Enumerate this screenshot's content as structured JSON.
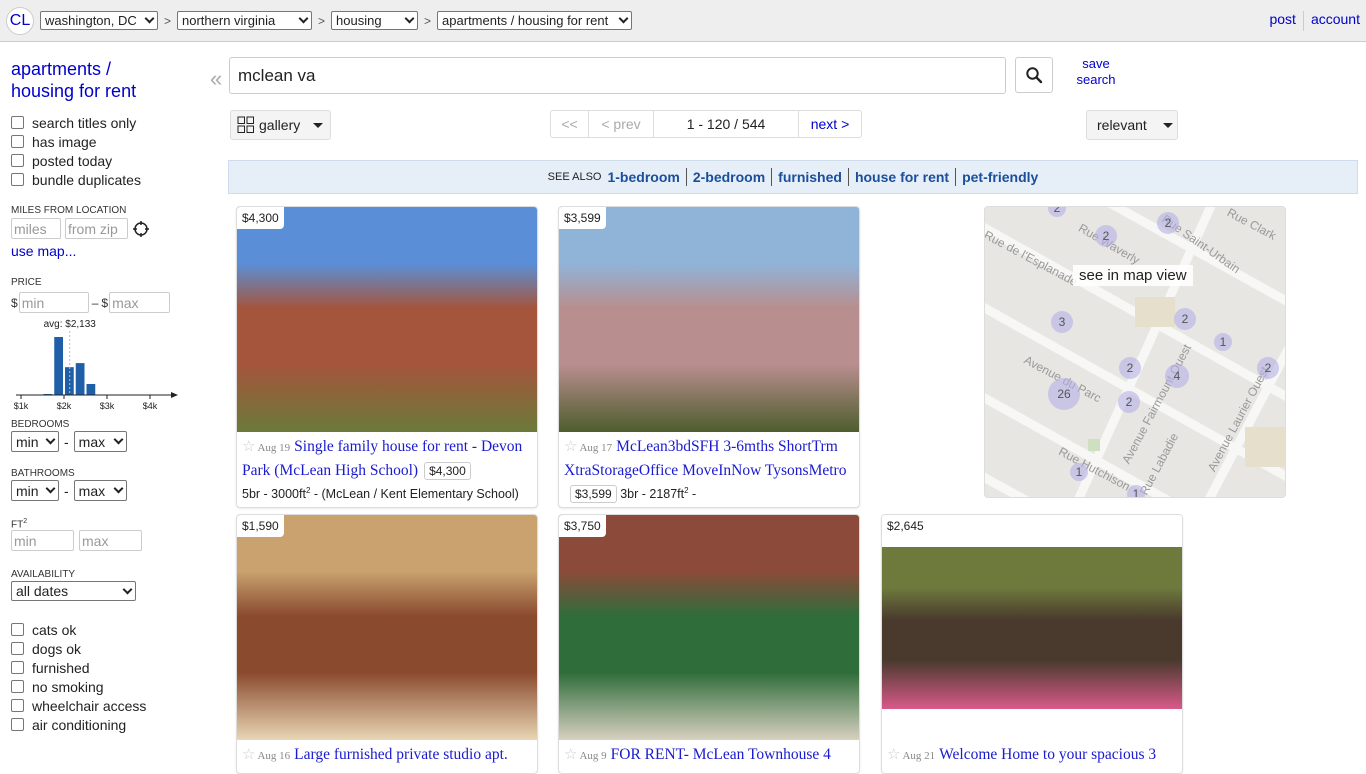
{
  "header": {
    "logo": "CL",
    "breadcrumbs": [
      {
        "value": "washington, DC"
      },
      {
        "value": "northern virginia"
      },
      {
        "value": "housing"
      },
      {
        "value": "apartments / housing for rent"
      }
    ],
    "separator": ">",
    "links": {
      "post": "post",
      "account": "account"
    }
  },
  "sidebar": {
    "category_title_1": "apartments /",
    "category_title_2": "housing for rent",
    "options": [
      "search titles only",
      "has image",
      "posted today",
      "bundle duplicates"
    ],
    "miles_label": "MILES FROM LOCATION",
    "miles_placeholder": "miles",
    "zip_placeholder": "from zip",
    "use_map": "use map...",
    "price_label": "PRICE",
    "currency": "$",
    "price_dash": "–",
    "min_placeholder": "min",
    "max_placeholder": "max",
    "histogram": {
      "avg_label": "avg: $2,133",
      "avg": 2133,
      "ticks": [
        "$1k",
        "$2k",
        "$3k",
        "$4k"
      ],
      "bins": [
        {
          "from": 1500,
          "to": 1750,
          "count": 1
        },
        {
          "from": 1750,
          "to": 2000,
          "count": 100
        },
        {
          "from": 2000,
          "to": 2250,
          "count": 48
        },
        {
          "from": 2250,
          "to": 2500,
          "count": 55
        },
        {
          "from": 2500,
          "to": 2750,
          "count": 19
        }
      ]
    },
    "bedrooms_label": "BEDROOMS",
    "bathrooms_label": "BATHROOMS",
    "sel_min": "min",
    "sel_max": "max",
    "range_dash": "-",
    "ft_label": "FT",
    "ft_sup": "2",
    "availability_label": "AVAILABILITY",
    "availability_value": "all dates",
    "amenities": [
      "cats ok",
      "dogs ok",
      "furnished",
      "no smoking",
      "wheelchair access",
      "air conditioning"
    ]
  },
  "search": {
    "collapse": "«",
    "query": "mclean va",
    "save_line1": "save",
    "save_line2": "search"
  },
  "toolbar": {
    "view": "gallery",
    "first": "<<",
    "prev": "< prev",
    "range": "1 - 120 / 544",
    "next": "next >",
    "sort": "relevant"
  },
  "see_also": {
    "label": "SEE ALSO",
    "links": [
      "1-bedroom",
      "2-bedroom",
      "furnished",
      "house for rent",
      "pet-friendly"
    ]
  },
  "listings": [
    {
      "price": "$4,300",
      "date": "Aug 19",
      "title": "Single family house for rent - Devon Park (McLean High School)",
      "meta_pre": "",
      "meta": "5br - 3000ft",
      "meta_sup": "2",
      "meta_post": " - (McLean / Kent Elementary School)",
      "colors": [
        "#5a8fd8",
        "#a4553c",
        "#6b7a3a"
      ]
    },
    {
      "price": "$3,599",
      "date": "Aug 17",
      "title": "McLean3bdSFH 3-6mths ShortTrm XtraStorageOffice MoveInNow TysonsMetro",
      "meta": "3br - 2187ft",
      "meta_sup": "2",
      "meta_post": " -",
      "colors": [
        "#8fb4d8",
        "#b88e8e",
        "#4e5d2e"
      ]
    },
    {
      "price": "$1,590",
      "date": "Aug 16",
      "title": "Large furnished private studio apt.",
      "colors": [
        "#c9a270",
        "#8a4a2e",
        "#e8d6b4"
      ]
    },
    {
      "price": "$3,750",
      "date": "Aug 9",
      "title": "FOR RENT- McLean Townhouse 4",
      "colors": [
        "#8c4a3a",
        "#2f6d3a",
        "#d8d0c0"
      ]
    },
    {
      "price": "$2,645",
      "date": "Aug 21",
      "title": "Welcome Home to your spacious 3",
      "colors": [
        "#6e7a3c",
        "#4a3a2e",
        "#d85a8a"
      ]
    }
  ],
  "map": {
    "label": "see in map view",
    "clusters": [
      "2",
      "2",
      "2",
      "3",
      "2",
      "1",
      "2",
      "4",
      "26",
      "2",
      "1",
      "1",
      "2"
    ],
    "streets": [
      "Rue de l'Esplanade",
      "Rue Waverly",
      "Rue Saint-Urbain",
      "Rue Clark",
      "Avenue du Parc",
      "Avenue Fairmount Ouest",
      "Avenue Laurier Ouest",
      "Rue Hutchison",
      "Rue Labadie"
    ]
  }
}
